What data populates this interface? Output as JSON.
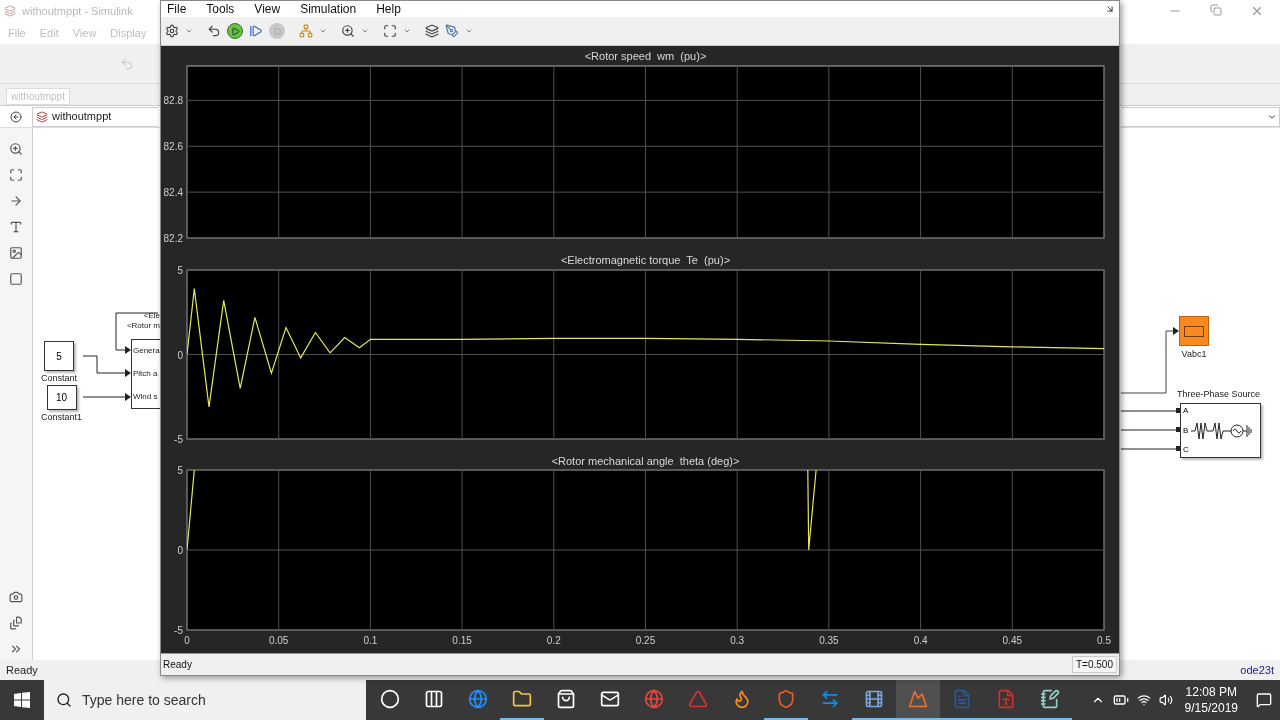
{
  "simulink": {
    "title": "withoutmppt - Simulink",
    "menu": [
      "File",
      "Edit",
      "View",
      "Display"
    ],
    "tab": "withoutmppt",
    "breadcrumb": "withoutmppt",
    "status": "Ready",
    "solver": "ode23t",
    "constants": [
      {
        "value": "5",
        "label": "Constant"
      },
      {
        "value": "10",
        "label": "Constant1"
      }
    ],
    "subsystem": {
      "outputs": [
        "<Ele",
        "<Rotor m"
      ],
      "inputs": [
        "Genera",
        "Pitch a",
        "Wind s"
      ]
    },
    "scope_block": {
      "label": "Vabc1"
    },
    "source_block": {
      "label": "Three-Phase Source",
      "ports": [
        "A",
        "B",
        "C"
      ]
    }
  },
  "scope": {
    "menu": [
      "File",
      "Tools",
      "View",
      "Simulation",
      "Help"
    ],
    "status": "Ready",
    "time": "T=0.500",
    "charts": [
      {
        "chart_data": {
          "type": "line",
          "title": "<Rotor speed  wm  (pu)>",
          "xlim": [
            0,
            0.5
          ],
          "ylim": [
            82.2,
            82.95
          ],
          "yticks": [
            82.2,
            82.4,
            82.6,
            82.8
          ],
          "grid": true
        }
      },
      {
        "chart_data": {
          "type": "line",
          "title": "<Electromagnetic torque  Te  (pu)>",
          "xlim": [
            0,
            0.5
          ],
          "ylim": [
            -5,
            5
          ],
          "yticks": [
            -5,
            0,
            5
          ],
          "grid": true,
          "x": [
            0,
            0.004,
            0.012,
            0.02,
            0.029,
            0.037,
            0.046,
            0.054,
            0.062,
            0.07,
            0.078,
            0.086,
            0.094,
            0.1,
            0.15,
            0.2,
            0.25,
            0.3,
            0.35,
            0.4,
            0.45,
            0.5
          ],
          "series": [
            {
              "color": "#e6e65a",
              "values": [
                0,
                3.9,
                -3.1,
                3.2,
                -2,
                2.2,
                -1.1,
                1.6,
                -0.2,
                1.3,
                0.1,
                1.0,
                0.4,
                0.9,
                0.9,
                0.95,
                0.95,
                0.9,
                0.8,
                0.6,
                0.45,
                0.35
              ]
            }
          ]
        }
      },
      {
        "chart_data": {
          "type": "line",
          "title": "<Rotor mechanical angle  theta (deg)>",
          "xlim": [
            0,
            0.5
          ],
          "ylim": [
            -5,
            5
          ],
          "xticks": [
            0,
            0.05,
            0.1,
            0.15,
            0.2,
            0.25,
            0.3,
            0.35,
            0.4,
            0.45,
            0.5
          ],
          "yticks": [
            -5,
            0,
            5
          ],
          "grid": true,
          "x": [
            0,
            0.004,
            0.3385,
            0.339,
            0.343
          ],
          "series": [
            {
              "color": "#e6e65a",
              "values": [
                0,
                5,
                5,
                0,
                5
              ]
            }
          ]
        }
      }
    ]
  },
  "taskbar": {
    "search": {
      "placeholder": "Type here to search"
    },
    "time": "12:08 PM",
    "date": "9/15/2019",
    "apps": [
      {
        "kind": "cortana",
        "running": false,
        "active": false
      },
      {
        "kind": "taskview",
        "running": false,
        "active": false
      },
      {
        "kind": "edge",
        "running": false,
        "active": false
      },
      {
        "kind": "explorer",
        "running": true,
        "active": false
      },
      {
        "kind": "store",
        "running": false,
        "active": false
      },
      {
        "kind": "mail",
        "running": false,
        "active": false
      },
      {
        "kind": "chrome",
        "running": false,
        "active": false
      },
      {
        "kind": "autocad",
        "running": false,
        "active": false
      },
      {
        "kind": "firefox",
        "running": false,
        "active": false
      },
      {
        "kind": "brave",
        "running": true,
        "active": false
      },
      {
        "kind": "teamviewer",
        "running": false,
        "active": false
      },
      {
        "kind": "video",
        "running": true,
        "active": false
      },
      {
        "kind": "matlab",
        "running": true,
        "active": true
      },
      {
        "kind": "word",
        "running": true,
        "active": false
      },
      {
        "kind": "acrobat",
        "running": true,
        "active": false
      },
      {
        "kind": "notes",
        "running": true,
        "active": false
      }
    ]
  }
}
